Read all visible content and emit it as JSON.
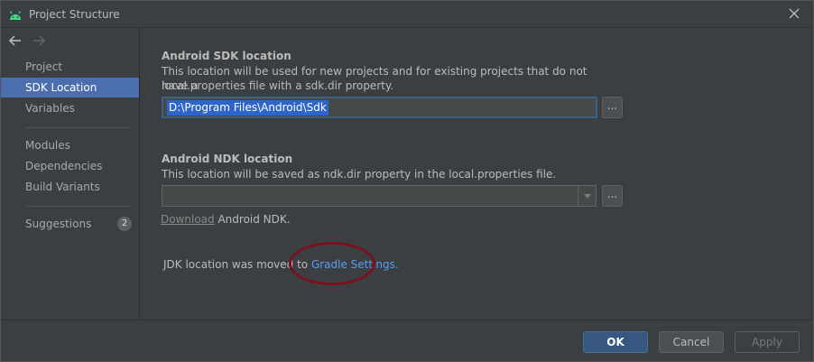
{
  "window": {
    "title": "Project Structure",
    "app_icon": "android-icon",
    "close_icon": "close-icon"
  },
  "nav": {
    "back_icon": "arrow-left-icon",
    "forward_icon": "arrow-right-icon"
  },
  "sidebar": {
    "items": [
      {
        "label": "Project",
        "selected": false
      },
      {
        "label": "SDK Location",
        "selected": true
      },
      {
        "label": "Variables",
        "selected": false
      },
      {
        "label": "Modules",
        "selected": false
      },
      {
        "label": "Dependencies",
        "selected": false
      },
      {
        "label": "Build Variants",
        "selected": false
      },
      {
        "label": "Suggestions",
        "selected": false,
        "badge": "2"
      }
    ]
  },
  "sdk": {
    "title": "Android SDK location",
    "desc_line1": "This location will be used for new projects and for existing projects that do not have a",
    "desc_line2": "local.properties file with a sdk.dir property.",
    "path": "D:\\Program Files\\Android\\Sdk",
    "browse_label": "..."
  },
  "ndk": {
    "title": "Android NDK location",
    "desc": "This location will be saved as ndk.dir property in the local.properties file.",
    "path": "",
    "browse_label": "...",
    "download_link": "Download",
    "download_suffix": " Android NDK."
  },
  "jdk": {
    "text": "JDK location was moved to ",
    "link": "Gradle Settings."
  },
  "footer": {
    "ok_label": "OK",
    "cancel_label": "Cancel",
    "apply_label": "Apply"
  },
  "colors": {
    "accent": "#4b6eaf",
    "link": "#589df6",
    "annotation": "#7a1020",
    "background": "#3c3f41"
  }
}
